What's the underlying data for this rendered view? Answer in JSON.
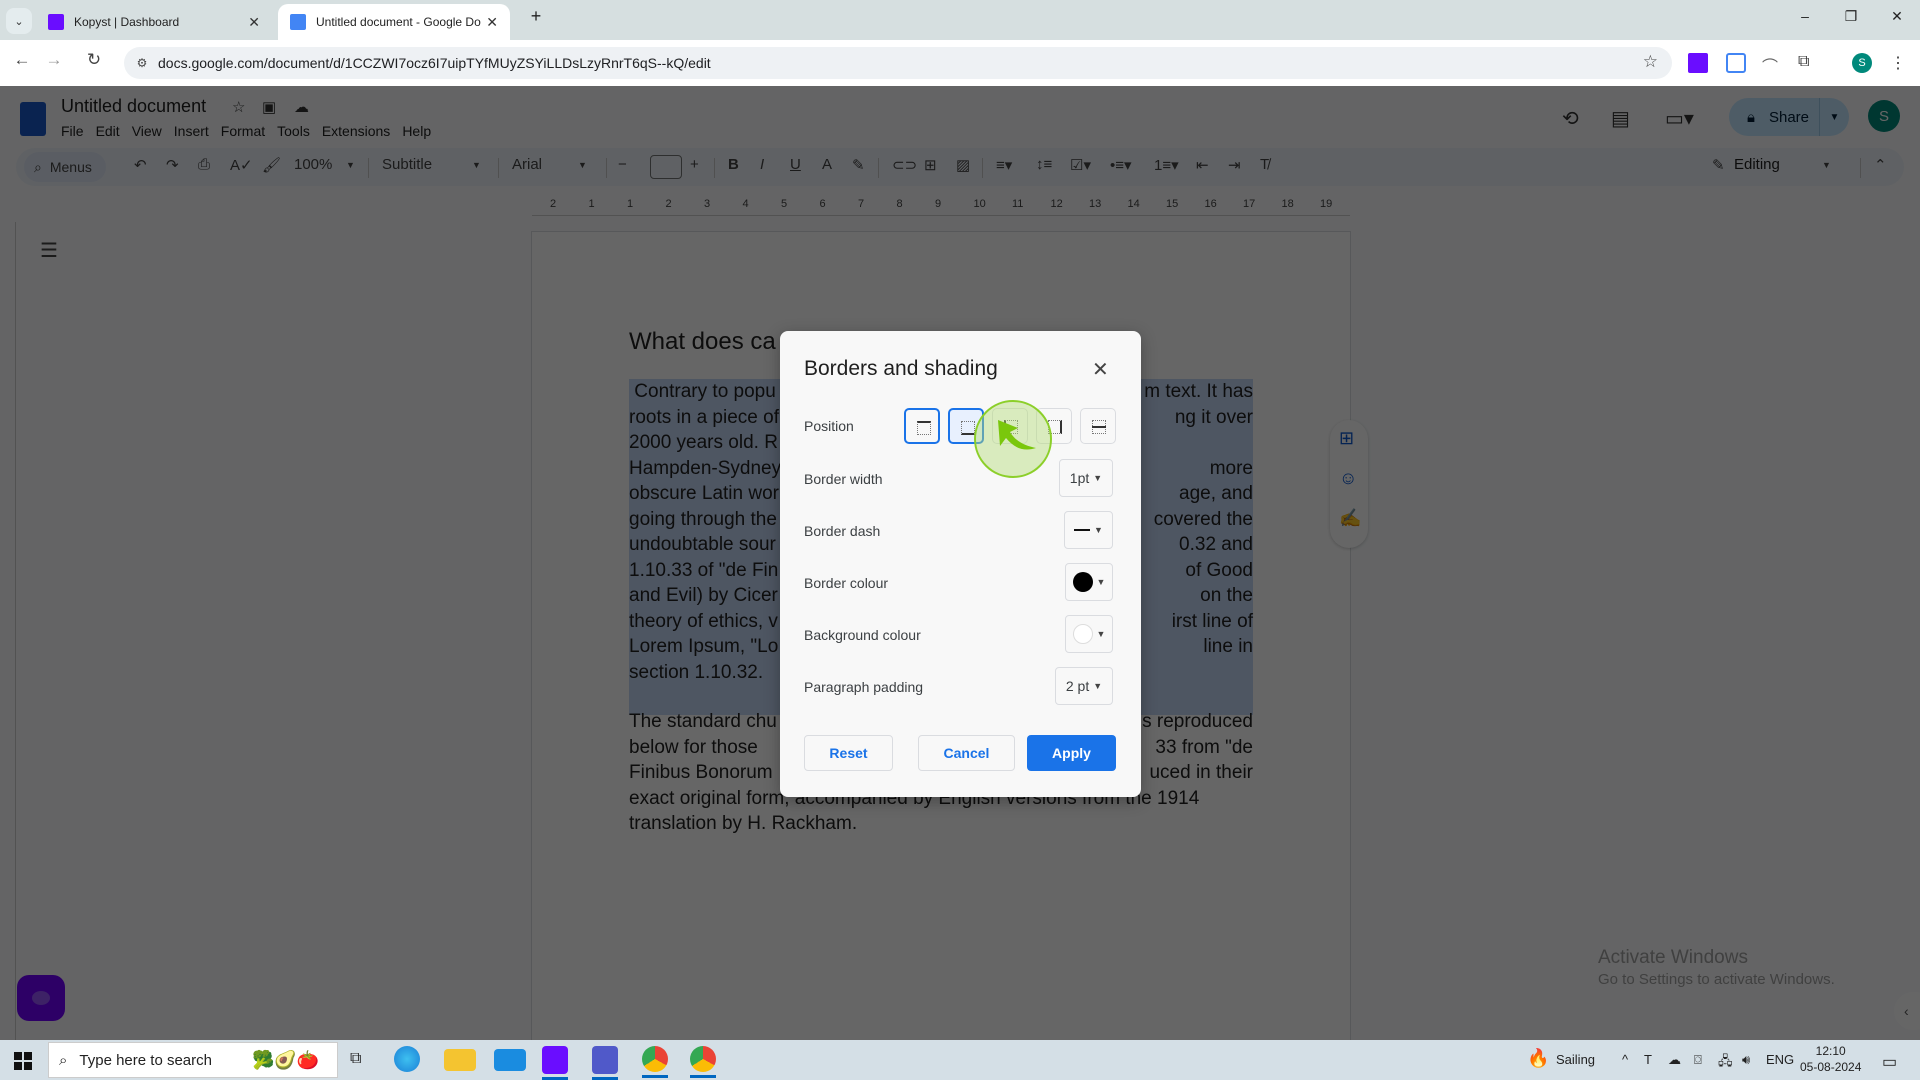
{
  "browser": {
    "tabs": [
      {
        "label": "Kopyst | Dashboard",
        "icon": "kopyst-icon",
        "active": false
      },
      {
        "label": "Untitled document - Google Do",
        "icon": "docs-icon",
        "active": true
      }
    ],
    "new_tab": "+",
    "url": "docs.google.com/document/d/1CCZWI7ocz6I7uipTYfMUyZSYiLLDsLzyRnrT6qS--kQ/edit",
    "profile_initial": "S",
    "window_controls": {
      "minimize": "–",
      "restore": "❐",
      "close": "✕"
    }
  },
  "docs": {
    "title": "Untitled document",
    "menu": [
      "File",
      "Edit",
      "View",
      "Insert",
      "Format",
      "Tools",
      "Extensions",
      "Help"
    ],
    "share_label": "Share",
    "avatar_initial": "S",
    "toolbar": {
      "menus_search": "Menus",
      "zoom": "100%",
      "style": "Subtitle",
      "font": "Arial",
      "font_size": "",
      "mode": "Editing"
    },
    "ruler_labels": [
      "2",
      "1",
      "1",
      "2",
      "3",
      "4",
      "5",
      "6",
      "7",
      "8",
      "9",
      "10",
      "11",
      "12",
      "13",
      "14",
      "15",
      "16",
      "17",
      "18",
      "19"
    ],
    "heading": "What does ca",
    "paragraph1": " Contrary to popu                                                m text. It has roots in a piece of                                                ng it over 2000 years old. R                                                Hampden-Sydney                                                more obscure Latin wor                                                age, and going through the                                                covered the undoubtable sour                                                0.32 and 1.10.33 of \"de Fin                                                of Good and Evil) by Cicer                                                on the theory of ethics, v                                                irst line of Lorem Ipsum, \"Lo                                                line in section 1.10.32.",
    "paragraph1_lines": [
      " Contrary to popu|m text. It has",
      "roots in a piece of|ng it over",
      "2000 years old. R|",
      "Hampden-Sydney|more",
      "obscure Latin wor|age, and",
      "going through the|covered the",
      "undoubtable sour|0.32 and",
      "1.10.33 of \"de Fin| of Good",
      "and Evil) by Cicer|on the",
      "theory of ethics, v|irst line of",
      "Lorem Ipsum, \"Lo|line in",
      "section 1.10.32.|"
    ],
    "paragraph2_lines": [
      "The standard chu|s reproduced",
      "below for those|33 from \"de",
      "Finibus Bonorum|uced in their",
      "exact original form, accompanied by English versions from the 1914",
      "translation by H. Rackham."
    ],
    "watermark": {
      "title": "Activate Windows",
      "subtitle": "Go to Settings to activate Windows."
    }
  },
  "dialog": {
    "title": "Borders and shading",
    "position_label": "Position",
    "positions": [
      {
        "name": "top",
        "selected": true
      },
      {
        "name": "bottom",
        "selected": true
      },
      {
        "name": "left",
        "selected": false
      },
      {
        "name": "right",
        "selected": false
      },
      {
        "name": "between",
        "selected": false
      }
    ],
    "border_width": {
      "label": "Border width",
      "value": "1pt"
    },
    "border_dash": {
      "label": "Border dash",
      "value": "solid"
    },
    "border_colour": {
      "label": "Border colour",
      "value": "#000000"
    },
    "background_colour": {
      "label": "Background colour",
      "value": "#ffffff"
    },
    "paragraph_padding": {
      "label": "Paragraph padding",
      "value": "2 pt"
    },
    "buttons": {
      "reset": "Reset",
      "cancel": "Cancel",
      "apply": "Apply"
    },
    "accent": "#1a73e8"
  },
  "taskbar": {
    "search_placeholder": "Type here to search",
    "weather_label": "Sailing",
    "language": "ENG",
    "time": "12:10",
    "date": "05-08-2024"
  }
}
